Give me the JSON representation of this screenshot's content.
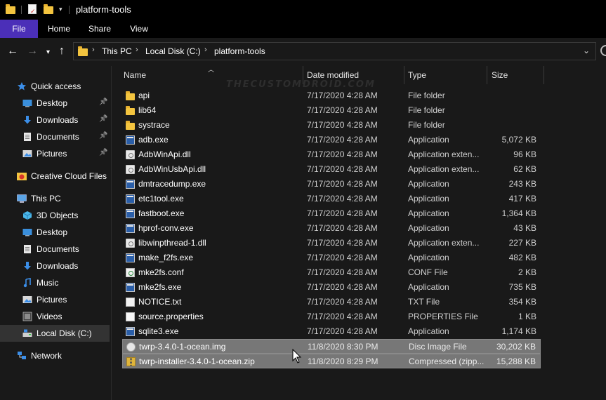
{
  "window": {
    "title": "platform-tools"
  },
  "ribbon": {
    "tabs": [
      {
        "label": "File"
      },
      {
        "label": "Home"
      },
      {
        "label": "Share"
      },
      {
        "label": "View"
      }
    ]
  },
  "address": {
    "crumbs": [
      "This PC",
      "Local Disk (C:)",
      "platform-tools"
    ]
  },
  "watermark": "THECUSTOMDROID.COM",
  "nav": {
    "items": [
      {
        "label": "Quick access",
        "icon": "star-icon",
        "indent": 0,
        "pinned": false,
        "selected": false
      },
      {
        "label": "Desktop",
        "icon": "desktop-icon",
        "indent": 1,
        "pinned": true,
        "selected": false
      },
      {
        "label": "Downloads",
        "icon": "download-icon",
        "indent": 1,
        "pinned": true,
        "selected": false
      },
      {
        "label": "Documents",
        "icon": "documents-icon",
        "indent": 1,
        "pinned": true,
        "selected": false
      },
      {
        "label": "Pictures",
        "icon": "pictures-icon",
        "indent": 1,
        "pinned": true,
        "selected": false
      },
      {
        "label": "Creative Cloud Files",
        "icon": "creative-cloud-icon",
        "indent": 0,
        "pinned": false,
        "selected": false
      },
      {
        "label": "This PC",
        "icon": "computer-icon",
        "indent": 0,
        "pinned": false,
        "selected": false
      },
      {
        "label": "3D Objects",
        "icon": "3d-objects-icon",
        "indent": 1,
        "pinned": false,
        "selected": false
      },
      {
        "label": "Desktop",
        "icon": "desktop-icon",
        "indent": 1,
        "pinned": false,
        "selected": false
      },
      {
        "label": "Documents",
        "icon": "documents-icon",
        "indent": 1,
        "pinned": false,
        "selected": false
      },
      {
        "label": "Downloads",
        "icon": "download-icon",
        "indent": 1,
        "pinned": false,
        "selected": false
      },
      {
        "label": "Music",
        "icon": "music-icon",
        "indent": 1,
        "pinned": false,
        "selected": false
      },
      {
        "label": "Pictures",
        "icon": "pictures-icon",
        "indent": 1,
        "pinned": false,
        "selected": false
      },
      {
        "label": "Videos",
        "icon": "videos-icon",
        "indent": 1,
        "pinned": false,
        "selected": false
      },
      {
        "label": "Local Disk (C:)",
        "icon": "drive-icon",
        "indent": 1,
        "pinned": false,
        "selected": true
      },
      {
        "label": "Network",
        "icon": "network-icon",
        "indent": 0,
        "pinned": false,
        "selected": false
      }
    ]
  },
  "columns": {
    "name": "Name",
    "date": "Date modified",
    "type": "Type",
    "size": "Size"
  },
  "files": [
    {
      "name": "api",
      "date": "7/17/2020 4:28 AM",
      "type": "File folder",
      "size": "",
      "icon": "folder-icon",
      "selected": false
    },
    {
      "name": "lib64",
      "date": "7/17/2020 4:28 AM",
      "type": "File folder",
      "size": "",
      "icon": "folder-icon",
      "selected": false
    },
    {
      "name": "systrace",
      "date": "7/17/2020 4:28 AM",
      "type": "File folder",
      "size": "",
      "icon": "folder-icon",
      "selected": false
    },
    {
      "name": "adb.exe",
      "date": "7/17/2020 4:28 AM",
      "type": "Application",
      "size": "5,072 KB",
      "icon": "application-icon",
      "selected": false
    },
    {
      "name": "AdbWinApi.dll",
      "date": "7/17/2020 4:28 AM",
      "type": "Application exten...",
      "size": "96 KB",
      "icon": "dll-icon",
      "selected": false
    },
    {
      "name": "AdbWinUsbApi.dll",
      "date": "7/17/2020 4:28 AM",
      "type": "Application exten...",
      "size": "62 KB",
      "icon": "dll-icon",
      "selected": false
    },
    {
      "name": "dmtracedump.exe",
      "date": "7/17/2020 4:28 AM",
      "type": "Application",
      "size": "243 KB",
      "icon": "application-icon",
      "selected": false
    },
    {
      "name": "etc1tool.exe",
      "date": "7/17/2020 4:28 AM",
      "type": "Application",
      "size": "417 KB",
      "icon": "application-icon",
      "selected": false
    },
    {
      "name": "fastboot.exe",
      "date": "7/17/2020 4:28 AM",
      "type": "Application",
      "size": "1,364 KB",
      "icon": "application-icon",
      "selected": false
    },
    {
      "name": "hprof-conv.exe",
      "date": "7/17/2020 4:28 AM",
      "type": "Application",
      "size": "43 KB",
      "icon": "application-icon",
      "selected": false
    },
    {
      "name": "libwinpthread-1.dll",
      "date": "7/17/2020 4:28 AM",
      "type": "Application exten...",
      "size": "227 KB",
      "icon": "dll-icon",
      "selected": false
    },
    {
      "name": "make_f2fs.exe",
      "date": "7/17/2020 4:28 AM",
      "type": "Application",
      "size": "482 KB",
      "icon": "application-icon",
      "selected": false
    },
    {
      "name": "mke2fs.conf",
      "date": "7/17/2020 4:28 AM",
      "type": "CONF File",
      "size": "2 KB",
      "icon": "conf-file-icon",
      "selected": false
    },
    {
      "name": "mke2fs.exe",
      "date": "7/17/2020 4:28 AM",
      "type": "Application",
      "size": "735 KB",
      "icon": "application-icon",
      "selected": false
    },
    {
      "name": "NOTICE.txt",
      "date": "7/17/2020 4:28 AM",
      "type": "TXT File",
      "size": "354 KB",
      "icon": "text-file-icon",
      "selected": false
    },
    {
      "name": "source.properties",
      "date": "7/17/2020 4:28 AM",
      "type": "PROPERTIES File",
      "size": "1 KB",
      "icon": "properties-file-icon",
      "selected": false
    },
    {
      "name": "sqlite3.exe",
      "date": "7/17/2020 4:28 AM",
      "type": "Application",
      "size": "1,174 KB",
      "icon": "application-icon",
      "selected": false
    },
    {
      "name": "twrp-3.4.0-1-ocean.img",
      "date": "11/8/2020 8:30 PM",
      "type": "Disc Image File",
      "size": "30,202 KB",
      "icon": "disc-image-icon",
      "selected": true
    },
    {
      "name": "twrp-installer-3.4.0-1-ocean.zip",
      "date": "11/8/2020 8:29 PM",
      "type": "Compressed (zipp...",
      "size": "15,288 KB",
      "icon": "zip-file-icon",
      "selected": true
    }
  ]
}
